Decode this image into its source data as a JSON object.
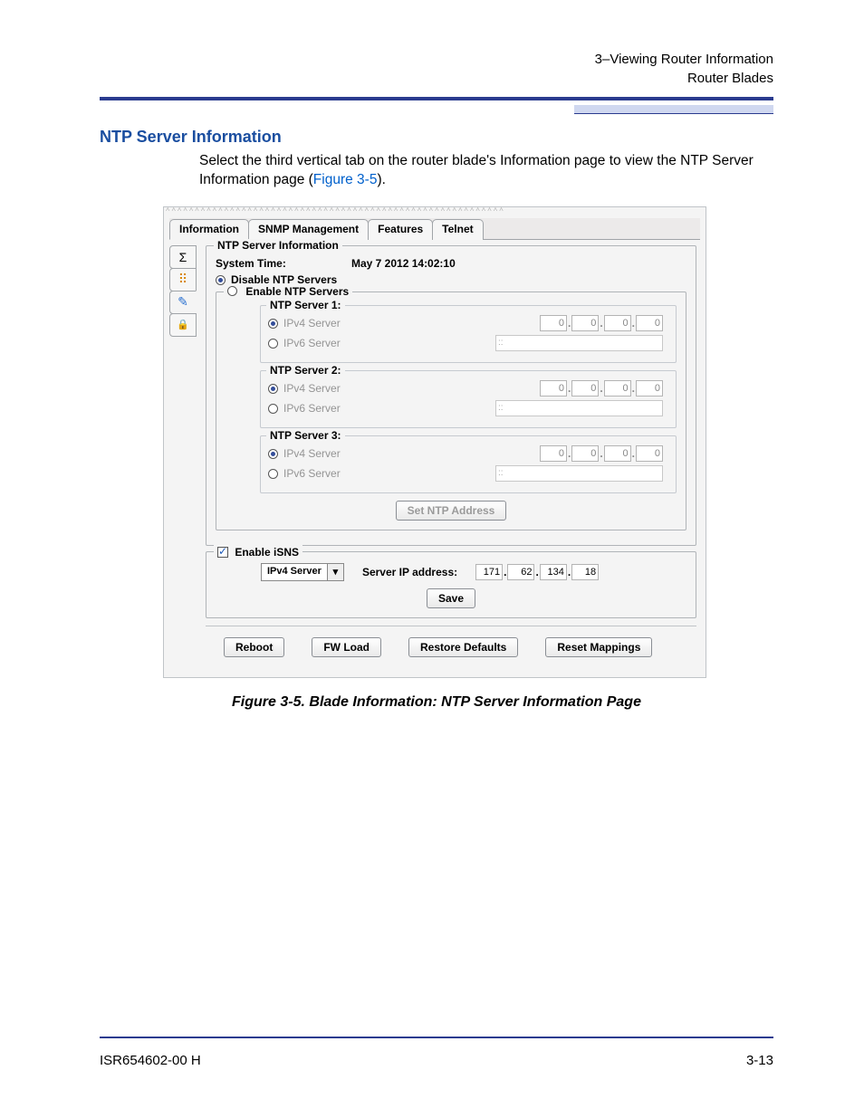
{
  "header": {
    "line1": "3–Viewing Router Information",
    "line2": "Router Blades"
  },
  "section_title": "NTP Server Information",
  "paragraph_pre": "Select the third vertical tab on the router blade's Information page to view the NTP Server Information page (",
  "paragraph_link": "Figure 3-5",
  "paragraph_post": ").",
  "tabs": [
    "Information",
    "SNMP Management",
    "Features",
    "Telnet"
  ],
  "active_tab_index": 0,
  "vtab_icons": [
    "Σ",
    "⠿",
    "✎",
    "🔒"
  ],
  "vtab_selected_index": 2,
  "ntp": {
    "group_legend": "NTP Server Information",
    "system_time_label": "System Time:",
    "system_time_value": "May 7 2012 14:02:10",
    "disable_label": "Disable NTP Servers",
    "enable_label": "Enable NTP Servers",
    "disable_selected": true,
    "servers": [
      {
        "legend": "NTP Server 1:",
        "ipv4_label": "IPv4 Server",
        "ipv6_label": "IPv6 Server",
        "ipv4_selected": true,
        "ip": [
          "0",
          "0",
          "0",
          "0"
        ],
        "ipv6": "::"
      },
      {
        "legend": "NTP Server 2:",
        "ipv4_label": "IPv4 Server",
        "ipv6_label": "IPv6 Server",
        "ipv4_selected": true,
        "ip": [
          "0",
          "0",
          "0",
          "0"
        ],
        "ipv6": "::"
      },
      {
        "legend": "NTP Server 3:",
        "ipv4_label": "IPv4 Server",
        "ipv6_label": "IPv6 Server",
        "ipv4_selected": true,
        "ip": [
          "0",
          "0",
          "0",
          "0"
        ],
        "ipv6": "::"
      }
    ],
    "set_button": "Set NTP Address"
  },
  "isns": {
    "legend": "Enable iSNS",
    "checked": true,
    "combo_label": "IPv4 Server",
    "ip_label": "Server IP address:",
    "ip": [
      "171",
      "62",
      "134",
      "18"
    ],
    "save_button": "Save"
  },
  "buttons": {
    "reboot": "Reboot",
    "fwload": "FW Load",
    "restore": "Restore Defaults",
    "reset": "Reset Mappings"
  },
  "caption": "Figure 3-5. Blade Information: NTP Server Information Page",
  "footer": {
    "left": "ISR654602-00  H",
    "right": "3-13"
  }
}
